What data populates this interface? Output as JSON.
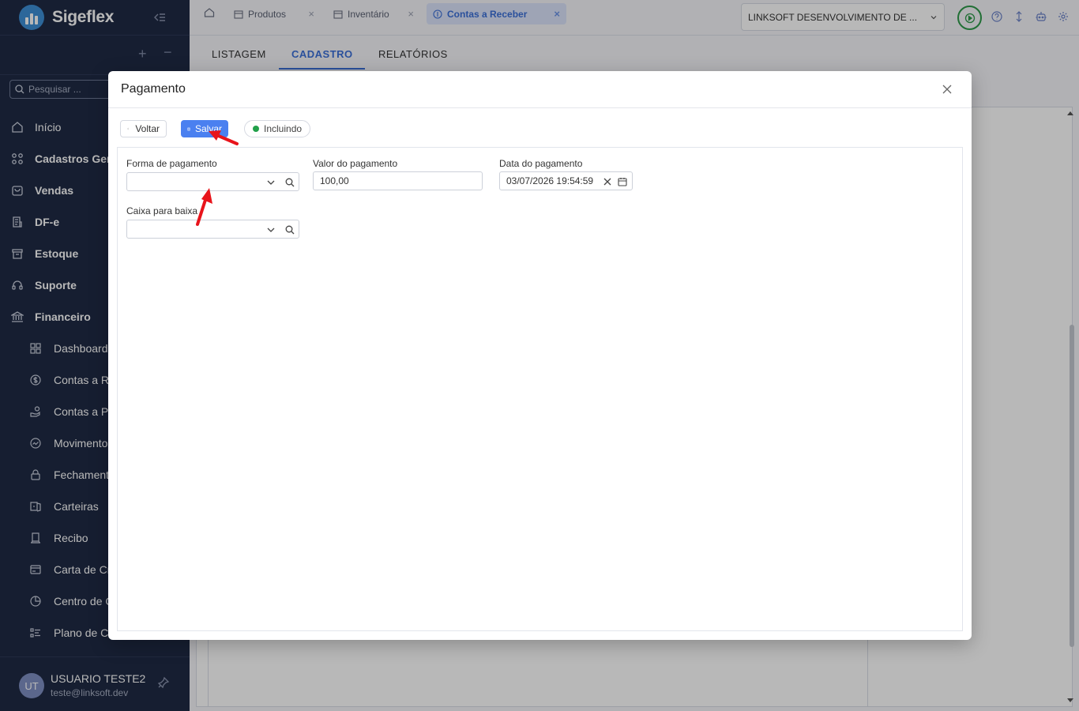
{
  "app": {
    "name": "Sigeflex"
  },
  "sidebar": {
    "search_placeholder": "Pesquisar ...",
    "items": [
      {
        "label": "Início",
        "icon": "home-icon"
      },
      {
        "label": "Cadastros Gerais",
        "icon": "grid-icon"
      },
      {
        "label": "Vendas",
        "icon": "shopping-bag-icon"
      },
      {
        "label": "DF-e",
        "icon": "document-icon"
      },
      {
        "label": "Estoque",
        "icon": "archive-icon"
      },
      {
        "label": "Suporte",
        "icon": "headset-icon"
      },
      {
        "label": "Financeiro",
        "icon": "bank-icon"
      }
    ],
    "sub_items": [
      {
        "label": "Dashboard",
        "icon": "dashboard-icon"
      },
      {
        "label": "Contas a Receber",
        "icon": "dollar-circle-icon"
      },
      {
        "label": "Contas a Pagar",
        "icon": "hand-coins-icon"
      },
      {
        "label": "Movimentos",
        "icon": "chart-circle-icon"
      },
      {
        "label": "Fechamentos",
        "icon": "lock-icon"
      },
      {
        "label": "Carteiras",
        "icon": "wallet-icon"
      },
      {
        "label": "Recibo",
        "icon": "receipt-icon"
      },
      {
        "label": "Carta de Crédito",
        "icon": "card-icon"
      },
      {
        "label": "Centro de Custo",
        "icon": "pie-icon"
      },
      {
        "label": "Plano de Contas",
        "icon": "list-icon"
      }
    ],
    "user": {
      "initials": "UT",
      "name": "USUARIO TESTE2",
      "email": "teste@linksoft.dev"
    }
  },
  "topbar": {
    "tabs": [
      {
        "label": "Produtos",
        "icon": "calendar-icon",
        "active": false
      },
      {
        "label": "Inventário",
        "icon": "calendar-icon",
        "active": false
      },
      {
        "label": "Contas a Receber",
        "icon": "dollar-circle-icon",
        "active": true
      }
    ],
    "company": "LINKSOFT DESENVOLVIMENTO DE ..."
  },
  "page": {
    "subtabs": [
      "LISTAGEM",
      "CADASTRO",
      "RELATÓRIOS"
    ],
    "active_subtab": "CADASTRO"
  },
  "modal": {
    "title": "Pagamento",
    "back_label": "Voltar",
    "save_label": "Salvar",
    "status": "Incluindo",
    "fields": {
      "forma_pagamento": {
        "label": "Forma de pagamento",
        "value": ""
      },
      "valor_pagamento": {
        "label": "Valor do pagamento",
        "value": "100,00"
      },
      "data_pagamento": {
        "label": "Data do pagamento",
        "value": "03/07/2026 19:54:59"
      },
      "caixa_baixa": {
        "label": "Caixa para baixa",
        "value": ""
      }
    }
  },
  "colors": {
    "sidebar": "#1f2a44",
    "accent": "#4a80f0",
    "status": "#22a04a",
    "annotation": "#e8141b"
  }
}
